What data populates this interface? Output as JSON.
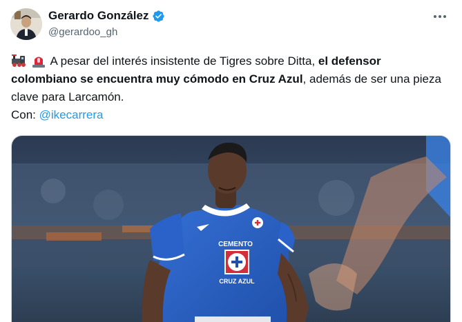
{
  "author": {
    "display_name": "Gerardo González",
    "handle": "@gerardoo_gh",
    "verified": true
  },
  "tweet": {
    "emojis": [
      "steam-locomotive-icon",
      "rotating-light-icon"
    ],
    "text_part1": " A pesar del interés insistente de Tigres sobre Ditta, ",
    "text_bold": "el defensor colombiano se encuentra muy cómodo en Cruz Azul",
    "text_part2": ", además de ser una pieza clave para Larcamón.",
    "credit_prefix": "Con: ",
    "mention": "@ikecarrera"
  },
  "media": {
    "jersey_sponsor": "CEMENTO",
    "jersey_club": "CRUZ AZUL"
  },
  "colors": {
    "accent": "#1d9bf0",
    "jersey": "#2a62c9"
  }
}
